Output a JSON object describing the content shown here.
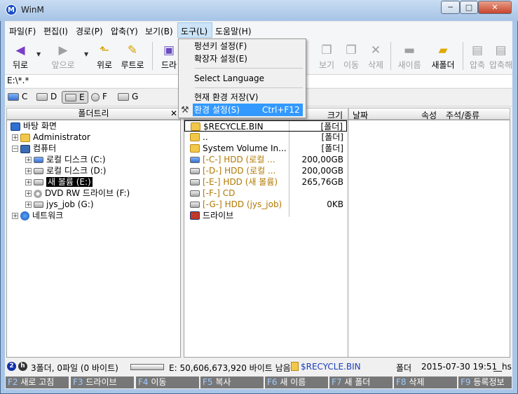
{
  "window": {
    "title": "WinM",
    "app_icon": "M",
    "min": "─",
    "max": "□",
    "close": "✕"
  },
  "menu": [
    "파일(F)",
    "편집(I)",
    "경로(P)",
    "압축(Y)",
    "보기(B)",
    "도구(L)",
    "도움말(H)"
  ],
  "toolbar": {
    "back": "뒤로",
    "forward": "앞으로",
    "up": "위로",
    "root": "루트로",
    "drive": "드라",
    "view": "보기",
    "move": "이동",
    "delete": "삭제",
    "rename": "새이름",
    "newfolder": "새폴더",
    "compress": "압축",
    "extract": "압축해"
  },
  "path": "E:\\*.*",
  "drives": [
    "C",
    "D",
    "E",
    "F",
    "G"
  ],
  "tree": {
    "header": "폴더트리",
    "close": "✕",
    "items": [
      {
        "label": "바탕 화면"
      },
      {
        "label": "Administrator"
      },
      {
        "label": "컴퓨터"
      },
      {
        "label": "로컬 디스크 (C:)"
      },
      {
        "label": "로컬 디스크 (D:)"
      },
      {
        "label": "새 볼륨 (E:)"
      },
      {
        "label": "DVD RW 드라이브 (F:)"
      },
      {
        "label": "jys_job (G:)"
      },
      {
        "label": "네트워크"
      }
    ]
  },
  "files": {
    "col_size": "크기",
    "rows": [
      {
        "name": "$RECYCLE.BIN",
        "size": "[폴더]"
      },
      {
        "name": "..",
        "size": "[폴더]"
      },
      {
        "name": "System Volume In...",
        "size": "[폴더]"
      },
      {
        "name": "[-C-] HDD (로컬 ...",
        "size": "200,00GB"
      },
      {
        "name": "[-D-] HDD (로컬 ...",
        "size": "200,00GB"
      },
      {
        "name": "[-E-] HDD (새 볼륨)",
        "size": "265,76GB"
      },
      {
        "name": "[-F-] CD",
        "size": ""
      },
      {
        "name": "[-G-] HDD (jys_job)",
        "size": "0KB"
      },
      {
        "name": "드라이브",
        "size": ""
      }
    ]
  },
  "details": {
    "col_date": "날짜",
    "col_attr": "속성",
    "col_comment": "주석/종류"
  },
  "popup": [
    {
      "label": "펑션키 설정(F)",
      "shortcut": ""
    },
    {
      "label": "확장자 설정(E)",
      "shortcut": ""
    },
    {
      "label": "Select Language",
      "shortcut": ""
    },
    {
      "label": "현재 환경 저장(V)",
      "shortcut": ""
    },
    {
      "label": "환경 설정(S)",
      "shortcut": "Ctrl+F12"
    }
  ],
  "status": {
    "badges": [
      "2",
      "h"
    ],
    "counts": "3폴더, 0파일 (0 바이트)",
    "free": "E: 50,606,673,920 바이트 남음",
    "current": "$RECYCLE.BIN",
    "type": "폴더",
    "datetime": "2015-07-30 19:51",
    "attr": "__hs"
  },
  "fkeys": [
    {
      "key": "F2",
      "label": "새로 고침"
    },
    {
      "key": "F3",
      "label": "드라이브"
    },
    {
      "key": "F4",
      "label": "이동"
    },
    {
      "key": "F5",
      "label": "복사"
    },
    {
      "key": "F6",
      "label": "새 이름"
    },
    {
      "key": "F7",
      "label": "새 폴더"
    },
    {
      "key": "F8",
      "label": "삭제"
    },
    {
      "key": "F9",
      "label": "등록정보"
    }
  ]
}
